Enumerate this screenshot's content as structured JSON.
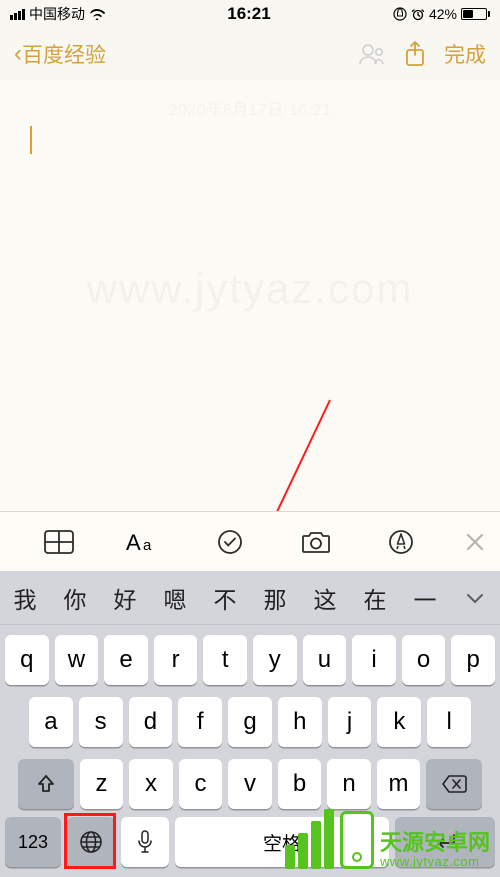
{
  "status": {
    "carrier": "中国移动",
    "time": "16:21",
    "battery_pct": "42%"
  },
  "nav": {
    "back_label": "百度经验",
    "done_label": "完成"
  },
  "note": {
    "timestamp": "2020年6月17日 16:21",
    "watermark": "www.jytyaz.com"
  },
  "toolbar": {
    "table_icon": "table-icon",
    "textstyle_icon": "textstyle-icon",
    "check_icon": "check-icon",
    "camera_icon": "camera-icon",
    "markup_icon": "markup-icon",
    "close_icon": "close-icon"
  },
  "keyboard": {
    "candidates": [
      "我",
      "你",
      "好",
      "嗯",
      "不",
      "那",
      "这",
      "在",
      "一"
    ],
    "row1": [
      "q",
      "w",
      "e",
      "r",
      "t",
      "y",
      "u",
      "i",
      "o",
      "p"
    ],
    "row2": [
      "a",
      "s",
      "d",
      "f",
      "g",
      "h",
      "j",
      "k",
      "l"
    ],
    "row3": [
      "z",
      "x",
      "c",
      "v",
      "b",
      "n",
      "m"
    ],
    "numkey": "123",
    "space_label": "空格"
  },
  "badge": {
    "title": "天源安卓网",
    "url": "www.jytyaz.com"
  }
}
